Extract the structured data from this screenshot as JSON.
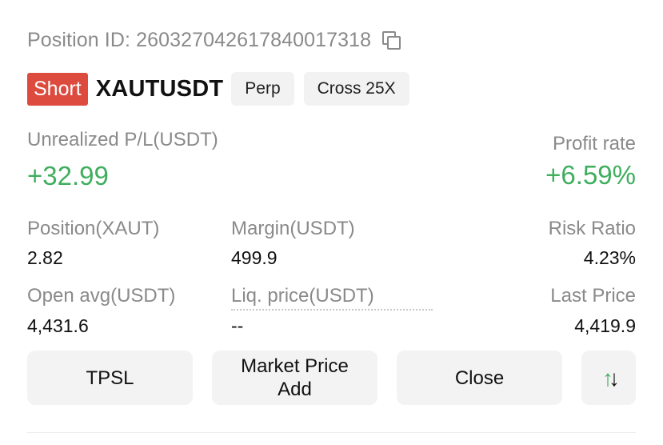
{
  "position": {
    "id_label": "Position ID: 260327042617840017318",
    "side": "Short",
    "symbol": "XAUTUSDT",
    "type_tag": "Perp",
    "leverage_tag": "Cross 25X"
  },
  "pnl": {
    "label": "Unrealized P/L(USDT)",
    "value": "+32.99",
    "rate_label": "Profit rate",
    "rate_value": "+6.59%"
  },
  "stats": {
    "position_label": "Position(XAUT)",
    "position_value": "2.82",
    "margin_label": "Margin(USDT)",
    "margin_value": "499.9",
    "risk_label": "Risk Ratio",
    "risk_value": "4.23%",
    "open_avg_label": "Open avg(USDT)",
    "open_avg_value": "4,431.6",
    "liq_label": "Liq. price(USDT)",
    "liq_value": "--",
    "last_price_label": "Last Price",
    "last_price_value": "4,419.9"
  },
  "actions": {
    "tpsl": "TPSL",
    "market_add_line1": "Market Price",
    "market_add_line2": "Add",
    "close": "Close",
    "swap_up": "↑",
    "swap_down": "↓"
  },
  "colors": {
    "short_red": "#dd4b3f",
    "profit_green": "#3fae5e",
    "muted_gray": "#8a8a8a",
    "button_bg": "#f3f3f3"
  },
  "icons": {
    "copy": "copy-icon",
    "swap": "swap-position-icon"
  }
}
